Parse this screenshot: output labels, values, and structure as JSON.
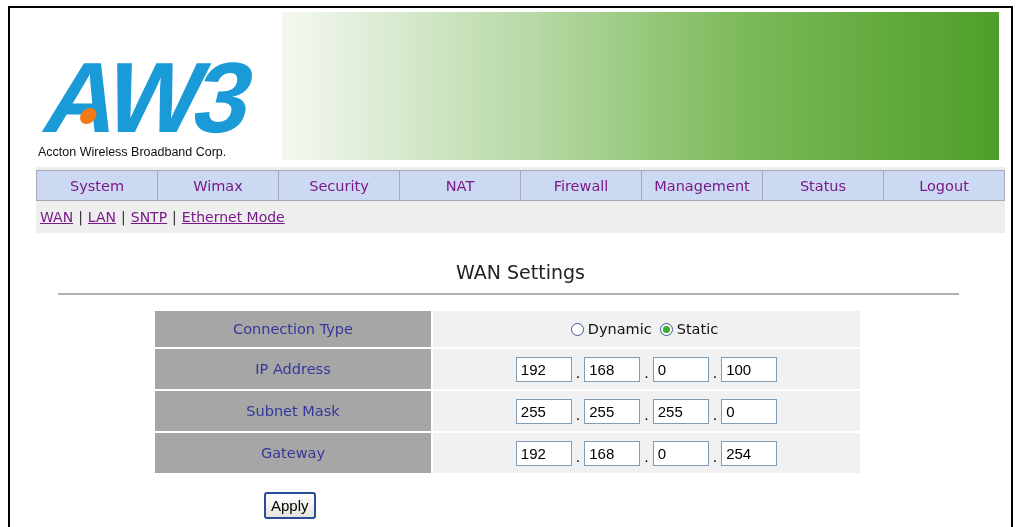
{
  "logo": {
    "mark": "AW3",
    "company": "Accton Wireless Broadband Corp."
  },
  "nav": [
    {
      "label": "System",
      "selected": false
    },
    {
      "label": "Wimax",
      "selected": false
    },
    {
      "label": "Security",
      "selected": false
    },
    {
      "label": "NAT",
      "selected": false
    },
    {
      "label": "Firewall",
      "selected": false
    },
    {
      "label": "Management",
      "selected": false
    },
    {
      "label": "Status",
      "selected": false
    },
    {
      "label": "Logout",
      "selected": false
    }
  ],
  "sublinks": [
    "WAN",
    "LAN",
    "SNTP",
    "Ethernet Mode"
  ],
  "separator": "|",
  "title": "WAN Settings",
  "form": {
    "rows": [
      {
        "kind": "radio",
        "label": "Connection Type",
        "options": [
          {
            "label": "Dynamic",
            "selected": false
          },
          {
            "label": "Static",
            "selected": true
          }
        ]
      },
      {
        "kind": "ip",
        "label": "IP Address",
        "octets": [
          "192",
          "168",
          "0",
          "100"
        ]
      },
      {
        "kind": "ip",
        "label": "Subnet Mask",
        "octets": [
          "255",
          "255",
          "255",
          "0"
        ]
      },
      {
        "kind": "ip",
        "label": "Gateway",
        "octets": [
          "192",
          "168",
          "0",
          "254"
        ]
      }
    ],
    "dot": "."
  },
  "apply": "Apply"
}
